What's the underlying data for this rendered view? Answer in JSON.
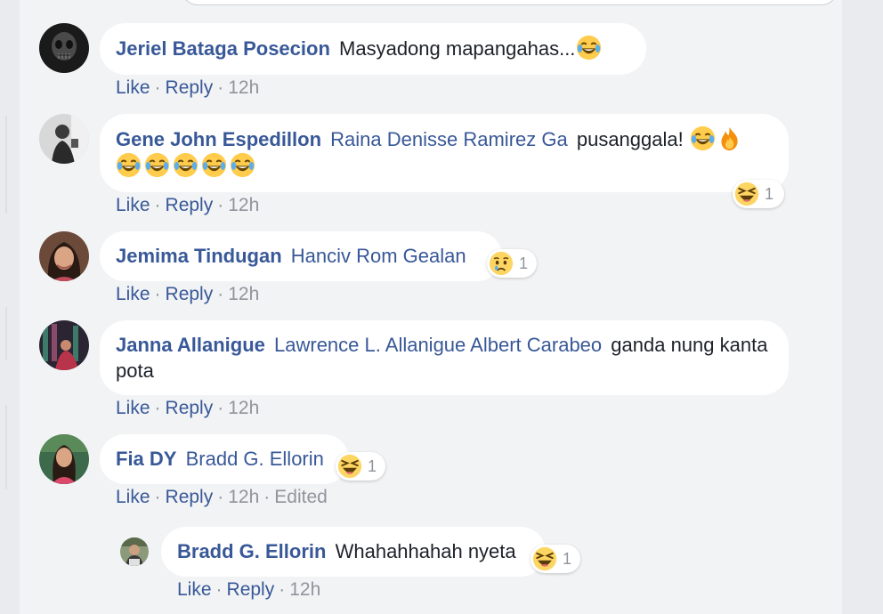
{
  "colors": {
    "author": "#385898",
    "text": "#1d2129",
    "meta": "#90949c",
    "bubble": "#ffffff",
    "page": "#f2f3f5"
  },
  "actions": {
    "like": "Like",
    "reply": "Reply",
    "sep": "·"
  },
  "comments": [
    {
      "author": "Jeriel Bataga Posecion",
      "tags": "",
      "text": "Masyadong mapangahas...",
      "emojis": [
        "laughing-tears-emoji"
      ],
      "time": "12h",
      "edited": "",
      "reaction_count": ""
    },
    {
      "author": "Gene John Espedillon",
      "tags": "Raina Denisse Ramirez Ga",
      "text": "pusanggala!",
      "emojis": [
        "laughing-tears-emoji",
        "fire-emoji",
        "laughing-tears-emoji",
        "laughing-tears-emoji",
        "laughing-tears-emoji",
        "laughing-tears-emoji",
        "laughing-tears-emoji"
      ],
      "time": "12h",
      "edited": "",
      "reaction_icon": "haha-reaction-icon",
      "reaction_count": "1"
    },
    {
      "author": "Jemima Tindugan",
      "tags": "Hanciv Rom Gealan",
      "text": "",
      "emojis": [],
      "time": "12h",
      "edited": "",
      "reaction_icon": "sad-reaction-icon",
      "reaction_count": "1"
    },
    {
      "author": "Janna Allanigue",
      "tags": "Lawrence L. Allanigue Albert Carabeo",
      "text": "ganda nung kanta pota",
      "emojis": [],
      "time": "12h",
      "edited": "",
      "reaction_count": ""
    },
    {
      "author": "Fia DY",
      "tags": "Bradd G. Ellorin",
      "text": "",
      "emojis": [],
      "time": "12h",
      "edited": "Edited",
      "reaction_icon": "haha-reaction-icon",
      "reaction_count": "1"
    },
    {
      "author": "Bradd G. Ellorin",
      "tags": "",
      "text": "Whahahhahah nyeta",
      "emojis": [],
      "time": "12h",
      "edited": "",
      "reaction_icon": "haha-reaction-icon",
      "reaction_count": "1",
      "is_reply": true
    }
  ]
}
